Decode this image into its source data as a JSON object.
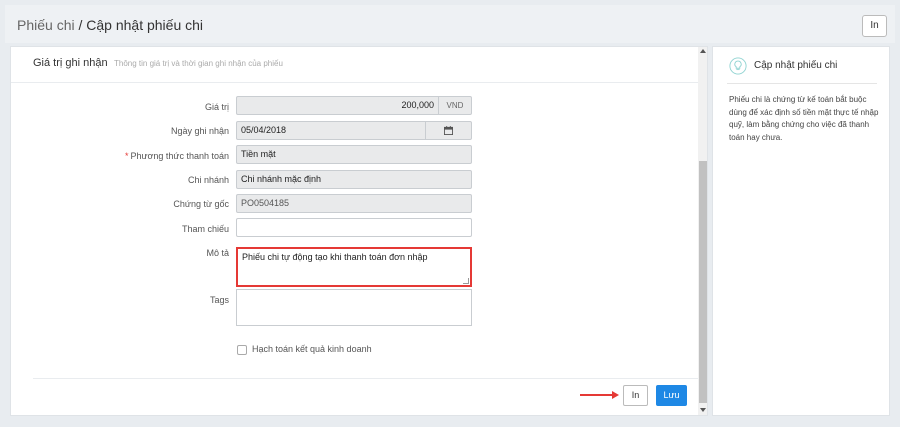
{
  "header": {
    "breadcrumb_parent": "Phiếu chi",
    "breadcrumb_sep": " / ",
    "breadcrumb_current": "Cập nhật phiếu chi",
    "print_label": "In"
  },
  "section": {
    "title": "Giá trị ghi nhận",
    "subtitle": "Thông tin giá trị và thời gian ghi nhận của phiếu"
  },
  "form": {
    "value_label": "Giá trị",
    "value": "200,000",
    "currency": "VND",
    "date_label": "Ngày ghi nhận",
    "date": "05/04/2018",
    "method_label": "Phương thức thanh toán",
    "method": "Tiền mặt",
    "branch_label": "Chi nhánh",
    "branch": "Chi nhánh mặc định",
    "source_label": "Chứng từ gốc",
    "source": "PO0504185",
    "reference_label": "Tham chiếu",
    "reference": "",
    "description_label": "Mô tả",
    "description": "Phiếu chi tự động tạo khi thanh toán đơn nhập",
    "tags_label": "Tags",
    "accounting_label": "Hạch toán kết quả kinh doanh"
  },
  "actions": {
    "print_label": "In",
    "save_label": "Lưu"
  },
  "side": {
    "title": "Cập nhật phiếu chi",
    "description": "Phiếu chi là chứng từ kế toán bắt buộc dùng để xác định số tiền mặt thực tế nhập quỹ, làm bằng chứng cho việc đã thanh toán hay chưa."
  },
  "colors": {
    "accent": "#1e88e5",
    "highlight": "#e53935",
    "bulb": "#8fd3d1"
  },
  "icons": {
    "calendar": "calendar-icon",
    "bulb": "lightbulb-icon",
    "arrow": "arrow-right-icon"
  }
}
